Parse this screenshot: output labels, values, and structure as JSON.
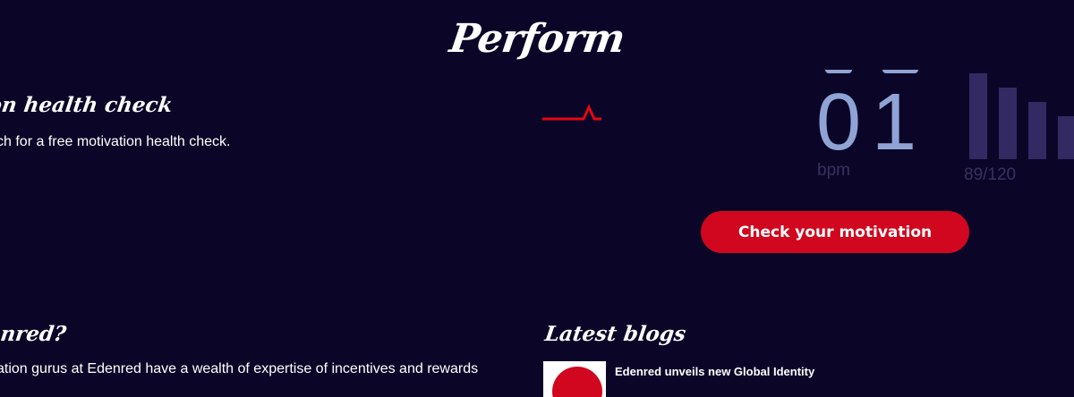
{
  "page": {
    "title": "Perform"
  },
  "health_check": {
    "heading": "ion health check",
    "text": "ch for a free motivation health check."
  },
  "monitor": {
    "bpm_value": "01",
    "bpm_unit": "bpm",
    "bars": [
      1.0,
      0.83,
      0.67,
      0.5
    ],
    "score": "89/120",
    "pulse_color": "#e30613",
    "digit_color": "#8fa4d4",
    "bar_color": "#332a63"
  },
  "cta": {
    "label": "Check your motivation",
    "color": "#d0071e"
  },
  "why": {
    "heading": "enred?",
    "text": "ation gurus at Edenred have a wealth of expertise of incentives and rewards"
  },
  "blogs": {
    "heading": "Latest blogs",
    "items": [
      {
        "title": "Edenred unveils new Global Identity"
      }
    ]
  },
  "theme": {
    "background": "#0b0628"
  }
}
